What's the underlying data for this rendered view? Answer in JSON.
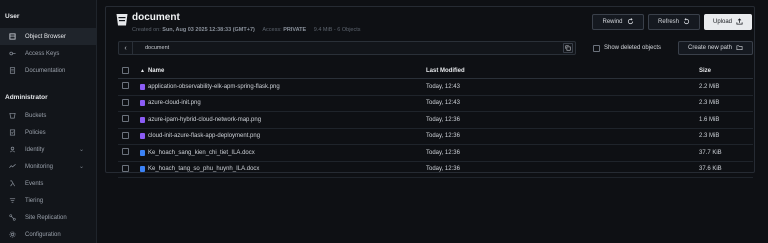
{
  "sidebar": {
    "user_section": "User",
    "user_items": [
      {
        "label": "Object Browser",
        "icon": "object-browser-icon",
        "active": true
      },
      {
        "label": "Access Keys",
        "icon": "key-icon",
        "active": false
      },
      {
        "label": "Documentation",
        "icon": "document-icon",
        "active": false
      }
    ],
    "admin_section": "Administrator",
    "admin_items": [
      {
        "label": "Buckets",
        "icon": "bucket-icon",
        "chevron": ""
      },
      {
        "label": "Policies",
        "icon": "policy-icon",
        "chevron": ""
      },
      {
        "label": "Identity",
        "icon": "identity-icon",
        "chevron": "⌄"
      },
      {
        "label": "Monitoring",
        "icon": "monitoring-icon",
        "chevron": "⌄"
      },
      {
        "label": "Events",
        "icon": "lambda-icon",
        "chevron": ""
      },
      {
        "label": "Tiering",
        "icon": "tiering-icon",
        "chevron": ""
      },
      {
        "label": "Site Replication",
        "icon": "replication-icon",
        "chevron": ""
      },
      {
        "label": "Configuration",
        "icon": "gear-icon",
        "chevron": ""
      }
    ]
  },
  "bucket": {
    "title": "document",
    "created_prefix": "Created on:",
    "created_value": "Sun, Aug 03 2025 12:38:33 (GMT+7)",
    "access_prefix": "Access:",
    "access_value": "PRIVATE",
    "stats": "9.4 MiB - 6 Objects"
  },
  "toolbar": {
    "rewind_label": "Rewind",
    "refresh_label": "Refresh",
    "upload_label": "Upload"
  },
  "pathbar": {
    "path": "document",
    "show_deleted_label": "Show deleted objects",
    "create_path_label": "Create new path"
  },
  "table": {
    "headers": {
      "name": "Name",
      "modified": "Last Modified",
      "size": "Size"
    },
    "rows": [
      {
        "name": "application-observability-elk-apm-spring-flask.png",
        "modified": "Today, 12:43",
        "size": "2.2 MiB",
        "type": "image"
      },
      {
        "name": "azure-cloud-init.png",
        "modified": "Today, 12:43",
        "size": "2.3 MiB",
        "type": "image"
      },
      {
        "name": "azure-ipam-hybrid-cloud-network-map.png",
        "modified": "Today, 12:36",
        "size": "1.6 MiB",
        "type": "image"
      },
      {
        "name": "cloud-init-azure-flask-app-deployment.png",
        "modified": "Today, 12:36",
        "size": "2.3 MiB",
        "type": "image"
      },
      {
        "name": "Ke_hoach_sang_kien_chi_tiet_ILA.docx",
        "modified": "Today, 12:36",
        "size": "37.7 KiB",
        "type": "doc"
      },
      {
        "name": "Ke_hoach_tang_so_phu_huynh_ILA.docx",
        "modified": "Today, 12:36",
        "size": "37.6 KiB",
        "type": "doc"
      }
    ]
  },
  "colors": {
    "image_icon": "#8b5cf6",
    "doc_icon": "#3b82f6",
    "accent": "#e9ebee"
  }
}
